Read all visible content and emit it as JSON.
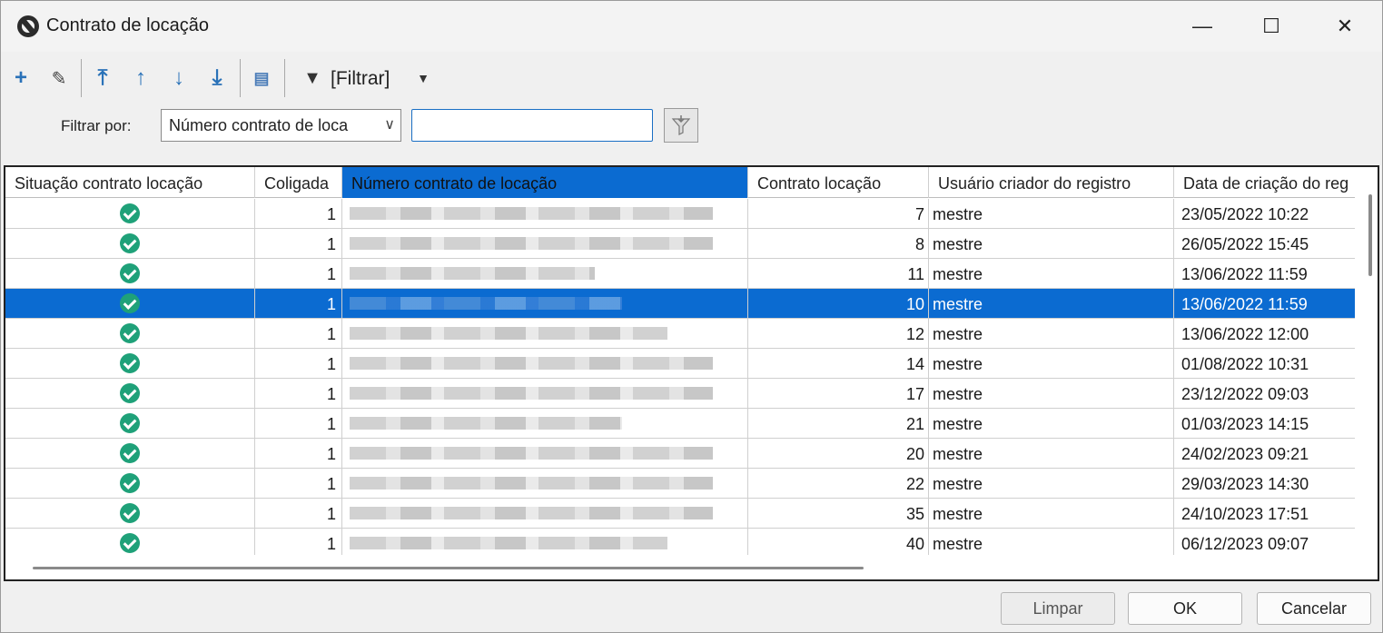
{
  "window": {
    "title": "Contrato de locação",
    "minimize_icon": "minimize-icon",
    "maximize_icon": "maximize-icon",
    "close_icon": "close-icon"
  },
  "toolbar": {
    "filter_label": "[Filtrar]",
    "buttons": [
      "add-icon",
      "edit-icon",
      "first-icon",
      "up-icon",
      "down-icon",
      "last-icon",
      "report-icon",
      "funnel-icon",
      "dropdown-arrow-icon"
    ]
  },
  "filter": {
    "label": "Filtrar por:",
    "field_value": "Número contrato de loca",
    "text_value": ""
  },
  "grid": {
    "columns": [
      "Situação contrato locação",
      "Coligada",
      "Número contrato de locação",
      "Contrato locação",
      "Usuário criador do registro",
      "Data de criação do reg"
    ],
    "rows": [
      {
        "coligada": "1",
        "contrato": "7",
        "usuario": "mestre",
        "data": "23/05/2022 10:22"
      },
      {
        "coligada": "1",
        "contrato": "8",
        "usuario": "mestre",
        "data": "26/05/2022 15:45"
      },
      {
        "coligada": "1",
        "contrato": "11",
        "usuario": "mestre",
        "data": "13/06/2022 11:59"
      },
      {
        "coligada": "1",
        "contrato": "10",
        "usuario": "mestre",
        "data": "13/06/2022 11:59"
      },
      {
        "coligada": "1",
        "contrato": "12",
        "usuario": "mestre",
        "data": "13/06/2022 12:00"
      },
      {
        "coligada": "1",
        "contrato": "14",
        "usuario": "mestre",
        "data": "01/08/2022 10:31"
      },
      {
        "coligada": "1",
        "contrato": "17",
        "usuario": "mestre",
        "data": "23/12/2022 09:03"
      },
      {
        "coligada": "1",
        "contrato": "21",
        "usuario": "mestre",
        "data": "01/03/2023 14:15"
      },
      {
        "coligada": "1",
        "contrato": "20",
        "usuario": "mestre",
        "data": "24/02/2023 09:21"
      },
      {
        "coligada": "1",
        "contrato": "22",
        "usuario": "mestre",
        "data": "29/03/2023 14:30"
      },
      {
        "coligada": "1",
        "contrato": "35",
        "usuario": "mestre",
        "data": "24/10/2023 17:51"
      },
      {
        "coligada": "1",
        "contrato": "40",
        "usuario": "mestre",
        "data": "06/12/2023 09:07"
      }
    ],
    "selected_index": 3
  },
  "footer": {
    "clear_label": "Limpar",
    "ok_label": "OK",
    "cancel_label": "Cancelar"
  }
}
